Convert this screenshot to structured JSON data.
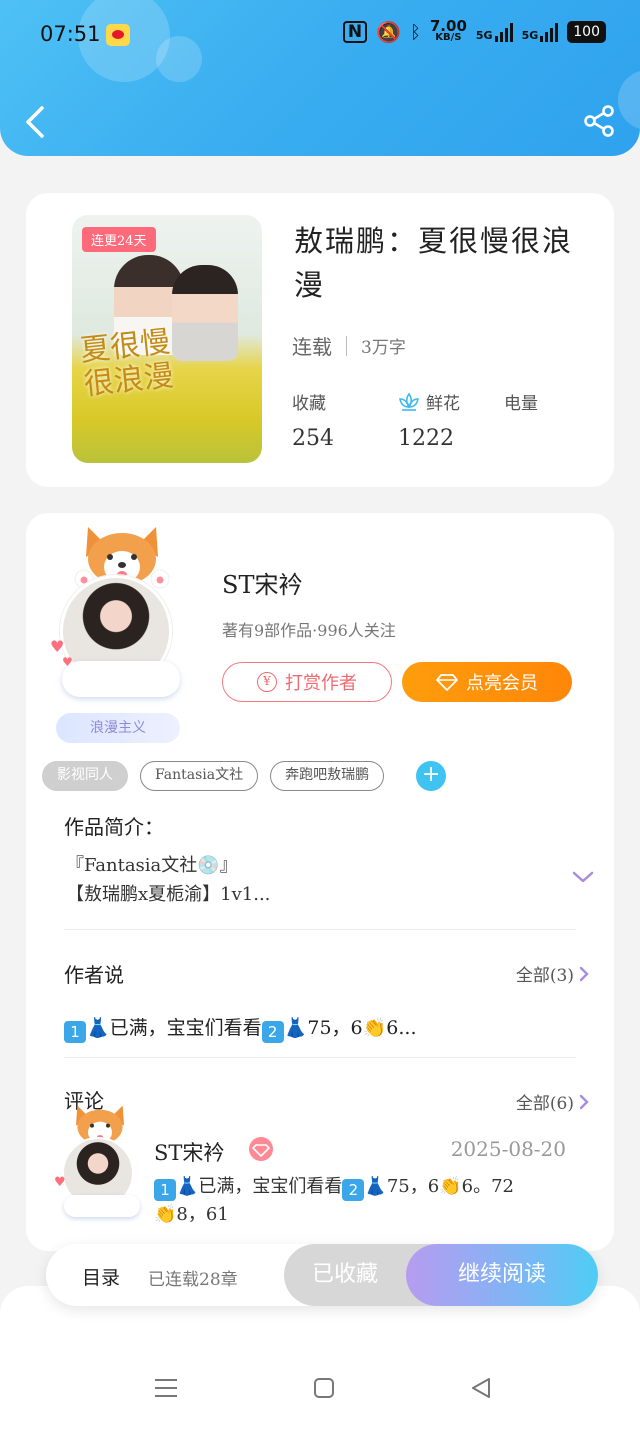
{
  "status_bar": {
    "time": "07:51",
    "nfc": "N",
    "speed_value": "7.00",
    "speed_unit": "KB/S",
    "sim1": "5G",
    "sim2": "5G",
    "battery": "100"
  },
  "header": {
    "back_icon": "chevron-left-icon",
    "share_icon": "share-icon"
  },
  "book": {
    "cover_badge": "连更24天",
    "cover_title": "夏很慢\n很浪漫",
    "title": "敖瑞鹏：夏很慢很浪漫",
    "status": "连载",
    "word_count": "3万字",
    "stats": [
      {
        "label": "收藏",
        "value": "254"
      },
      {
        "label": "鲜花",
        "value": "1222"
      },
      {
        "label": "电量",
        "value": ""
      }
    ]
  },
  "author": {
    "name": "ST宋衿",
    "info": "著有9部作品·996人关注",
    "tag": "浪漫主义",
    "reward_label": "打赏作者",
    "reward_coin": "¥",
    "member_label": "点亮会员"
  },
  "tags": [
    "影视同人",
    "Fantasia文社",
    "奔跑吧敖瑞鹏"
  ],
  "tag_add": "+",
  "intro": {
    "label": "作品简介：",
    "line1": "『Fantasia文社💿』",
    "line2": "【敖瑞鹏x夏栀渝】1v1..."
  },
  "author_says": {
    "label": "作者说",
    "all_link": "全部(3)",
    "n1": "1",
    "n2": "2",
    "part1": "已满，宝宝们看看",
    "part2": "75，6",
    "part3": "6..."
  },
  "comments": {
    "label": "评论",
    "all_link": "全部(6)",
    "name": "ST宋衿",
    "date": "2025-08-20",
    "n1": "1",
    "n2": "2",
    "part1": "已满，宝宝们看看",
    "part2": "75，6",
    "part3": "6。72",
    "part4": "8，61"
  },
  "action_bar": {
    "toc_label": "目录",
    "toc_count": "已连载28章",
    "fav_label": "已收藏",
    "read_label": "继续阅读"
  },
  "colors": {
    "header_blue": "#3aaef0",
    "member_orange": "#ff8f0a",
    "reward_red": "#ef6b71",
    "chevron_purple": "#a98be0"
  }
}
